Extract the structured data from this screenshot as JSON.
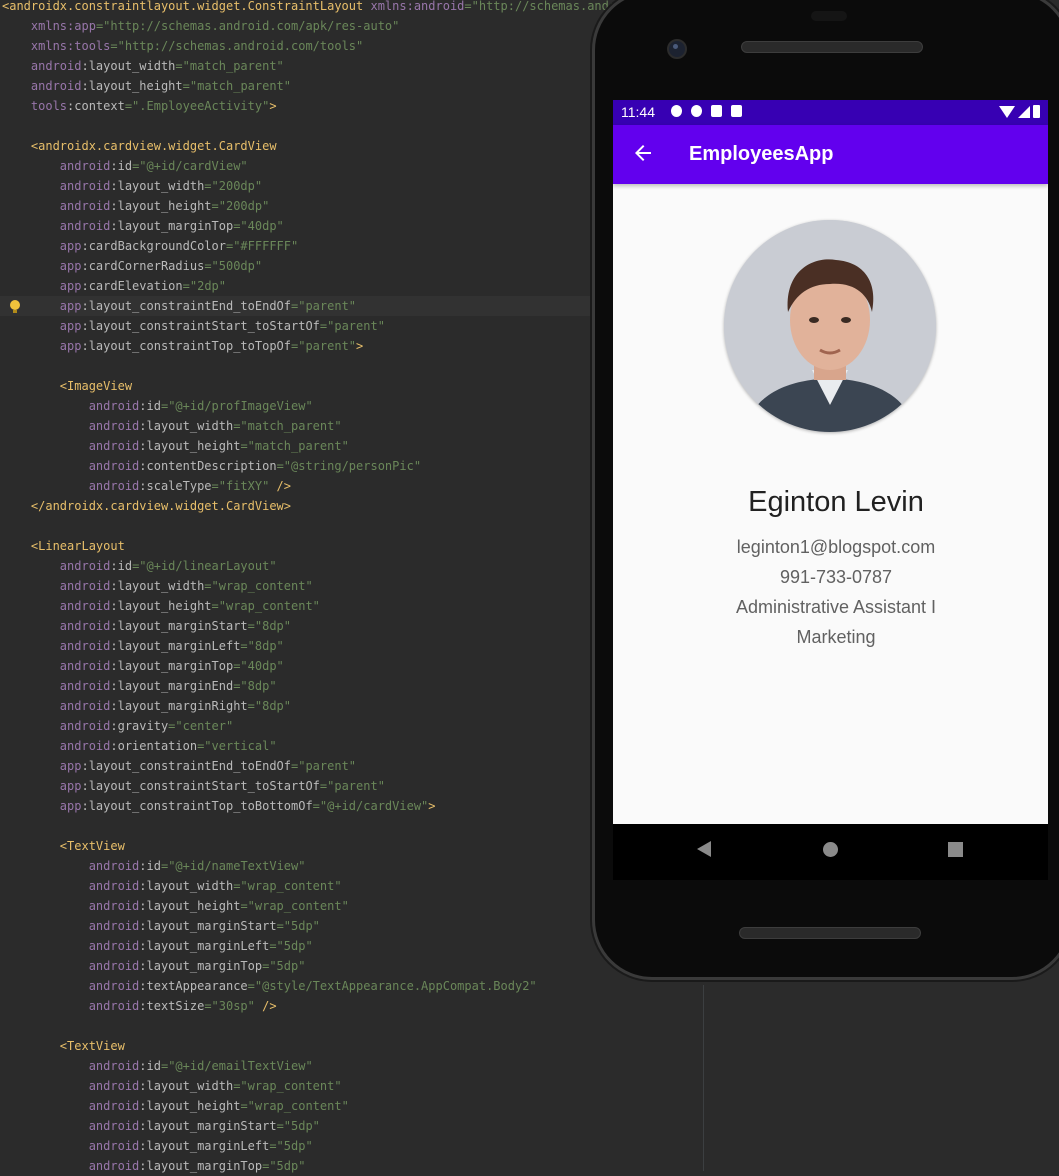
{
  "editor": {
    "lines": [
      [
        [
          "tag",
          "<androidx.constraintlayout.widget.ConstraintLayout "
        ],
        [
          "ns",
          "xmlns:android"
        ],
        [
          "str",
          "=\"http://schemas.andro"
        ]
      ],
      [
        [
          "txt",
          "    "
        ],
        [
          "ns",
          "xmlns:app"
        ],
        [
          "str",
          "=\"http://schemas.android.com/apk/res-auto\""
        ]
      ],
      [
        [
          "txt",
          "    "
        ],
        [
          "ns",
          "xmlns:tools"
        ],
        [
          "str",
          "=\"http://schemas.android.com/tools\""
        ]
      ],
      [
        [
          "txt",
          "    "
        ],
        [
          "ns",
          "android"
        ],
        [
          "at",
          ":layout_width"
        ],
        [
          "str",
          "=\"match_parent\""
        ]
      ],
      [
        [
          "txt",
          "    "
        ],
        [
          "ns",
          "android"
        ],
        [
          "at",
          ":layout_height"
        ],
        [
          "str",
          "=\"match_parent\""
        ]
      ],
      [
        [
          "txt",
          "    "
        ],
        [
          "ns",
          "tools"
        ],
        [
          "at",
          ":context"
        ],
        [
          "str",
          "=\".EmployeeActivity\""
        ],
        [
          "tag",
          ">"
        ]
      ],
      [
        [
          "txt",
          ""
        ]
      ],
      [
        [
          "txt",
          "    "
        ],
        [
          "tag",
          "<androidx.cardview.widget.CardView"
        ]
      ],
      [
        [
          "txt",
          "        "
        ],
        [
          "ns",
          "android"
        ],
        [
          "at",
          ":id"
        ],
        [
          "str",
          "=\"@+id/cardView\""
        ]
      ],
      [
        [
          "txt",
          "        "
        ],
        [
          "ns",
          "android"
        ],
        [
          "at",
          ":layout_width"
        ],
        [
          "str",
          "=\"200dp\""
        ]
      ],
      [
        [
          "txt",
          "        "
        ],
        [
          "ns",
          "android"
        ],
        [
          "at",
          ":layout_height"
        ],
        [
          "str",
          "=\"200dp\""
        ]
      ],
      [
        [
          "txt",
          "        "
        ],
        [
          "ns",
          "android"
        ],
        [
          "at",
          ":layout_marginTop"
        ],
        [
          "str",
          "=\"40dp\""
        ]
      ],
      [
        [
          "txt",
          "        "
        ],
        [
          "ns",
          "app"
        ],
        [
          "at",
          ":cardBackgroundColor"
        ],
        [
          "str",
          "=\"#FFFFFF\""
        ]
      ],
      [
        [
          "txt",
          "        "
        ],
        [
          "ns",
          "app"
        ],
        [
          "at",
          ":cardCornerRadius"
        ],
        [
          "str",
          "=\"500dp\""
        ]
      ],
      [
        [
          "txt",
          "        "
        ],
        [
          "ns",
          "app"
        ],
        [
          "at",
          ":cardElevation"
        ],
        [
          "str",
          "=\"2dp\""
        ]
      ],
      [
        [
          "txt",
          "        "
        ],
        [
          "ns",
          "app"
        ],
        [
          "at",
          ":layout_constraintEnd_toEndOf"
        ],
        [
          "str",
          "=\"parent\""
        ]
      ],
      [
        [
          "txt",
          "        "
        ],
        [
          "ns",
          "app"
        ],
        [
          "at",
          ":layout_constraintStart_toStartOf"
        ],
        [
          "str",
          "=\"parent\""
        ]
      ],
      [
        [
          "txt",
          "        "
        ],
        [
          "ns",
          "app"
        ],
        [
          "at",
          ":layout_constraintTop_toTopOf"
        ],
        [
          "str",
          "=\"parent\""
        ],
        [
          "tag",
          ">"
        ]
      ],
      [
        [
          "txt",
          ""
        ]
      ],
      [
        [
          "txt",
          "        "
        ],
        [
          "tag",
          "<ImageView"
        ]
      ],
      [
        [
          "txt",
          "            "
        ],
        [
          "ns",
          "android"
        ],
        [
          "at",
          ":id"
        ],
        [
          "str",
          "=\"@+id/profImageView\""
        ]
      ],
      [
        [
          "txt",
          "            "
        ],
        [
          "ns",
          "android"
        ],
        [
          "at",
          ":layout_width"
        ],
        [
          "str",
          "=\"match_parent\""
        ]
      ],
      [
        [
          "txt",
          "            "
        ],
        [
          "ns",
          "android"
        ],
        [
          "at",
          ":layout_height"
        ],
        [
          "str",
          "=\"match_parent\""
        ]
      ],
      [
        [
          "txt",
          "            "
        ],
        [
          "ns",
          "android"
        ],
        [
          "at",
          ":contentDescription"
        ],
        [
          "str",
          "=\"@string/personPic\""
        ]
      ],
      [
        [
          "txt",
          "            "
        ],
        [
          "ns",
          "android"
        ],
        [
          "at",
          ":scaleType"
        ],
        [
          "str",
          "=\"fitXY\""
        ],
        [
          "tag",
          " />"
        ]
      ],
      [
        [
          "txt",
          "    "
        ],
        [
          "tag",
          "</androidx.cardview.widget.CardView>"
        ]
      ],
      [
        [
          "txt",
          ""
        ]
      ],
      [
        [
          "txt",
          "    "
        ],
        [
          "tag",
          "<LinearLayout"
        ]
      ],
      [
        [
          "txt",
          "        "
        ],
        [
          "ns",
          "android"
        ],
        [
          "at",
          ":id"
        ],
        [
          "str",
          "=\"@+id/linearLayout\""
        ]
      ],
      [
        [
          "txt",
          "        "
        ],
        [
          "ns",
          "android"
        ],
        [
          "at",
          ":layout_width"
        ],
        [
          "str",
          "=\"wrap_content\""
        ]
      ],
      [
        [
          "txt",
          "        "
        ],
        [
          "ns",
          "android"
        ],
        [
          "at",
          ":layout_height"
        ],
        [
          "str",
          "=\"wrap_content\""
        ]
      ],
      [
        [
          "txt",
          "        "
        ],
        [
          "ns",
          "android"
        ],
        [
          "at",
          ":layout_marginStart"
        ],
        [
          "str",
          "=\"8dp\""
        ]
      ],
      [
        [
          "txt",
          "        "
        ],
        [
          "ns",
          "android"
        ],
        [
          "at",
          ":layout_marginLeft"
        ],
        [
          "str",
          "=\"8dp\""
        ]
      ],
      [
        [
          "txt",
          "        "
        ],
        [
          "ns",
          "android"
        ],
        [
          "at",
          ":layout_marginTop"
        ],
        [
          "str",
          "=\"40dp\""
        ]
      ],
      [
        [
          "txt",
          "        "
        ],
        [
          "ns",
          "android"
        ],
        [
          "at",
          ":layout_marginEnd"
        ],
        [
          "str",
          "=\"8dp\""
        ]
      ],
      [
        [
          "txt",
          "        "
        ],
        [
          "ns",
          "android"
        ],
        [
          "at",
          ":layout_marginRight"
        ],
        [
          "str",
          "=\"8dp\""
        ]
      ],
      [
        [
          "txt",
          "        "
        ],
        [
          "ns",
          "android"
        ],
        [
          "at",
          ":gravity"
        ],
        [
          "str",
          "=\"center\""
        ]
      ],
      [
        [
          "txt",
          "        "
        ],
        [
          "ns",
          "android"
        ],
        [
          "at",
          ":orientation"
        ],
        [
          "str",
          "=\"vertical\""
        ]
      ],
      [
        [
          "txt",
          "        "
        ],
        [
          "ns",
          "app"
        ],
        [
          "at",
          ":layout_constraintEnd_toEndOf"
        ],
        [
          "str",
          "=\"parent\""
        ]
      ],
      [
        [
          "txt",
          "        "
        ],
        [
          "ns",
          "app"
        ],
        [
          "at",
          ":layout_constraintStart_toStartOf"
        ],
        [
          "str",
          "=\"parent\""
        ]
      ],
      [
        [
          "txt",
          "        "
        ],
        [
          "ns",
          "app"
        ],
        [
          "at",
          ":layout_constraintTop_toBottomOf"
        ],
        [
          "str",
          "=\"@+id/cardView\""
        ],
        [
          "tag",
          ">"
        ]
      ],
      [
        [
          "txt",
          ""
        ]
      ],
      [
        [
          "txt",
          "        "
        ],
        [
          "tag",
          "<TextView"
        ]
      ],
      [
        [
          "txt",
          "            "
        ],
        [
          "ns",
          "android"
        ],
        [
          "at",
          ":id"
        ],
        [
          "str",
          "=\"@+id/nameTextView\""
        ]
      ],
      [
        [
          "txt",
          "            "
        ],
        [
          "ns",
          "android"
        ],
        [
          "at",
          ":layout_width"
        ],
        [
          "str",
          "=\"wrap_content\""
        ]
      ],
      [
        [
          "txt",
          "            "
        ],
        [
          "ns",
          "android"
        ],
        [
          "at",
          ":layout_height"
        ],
        [
          "str",
          "=\"wrap_content\""
        ]
      ],
      [
        [
          "txt",
          "            "
        ],
        [
          "ns",
          "android"
        ],
        [
          "at",
          ":layout_marginStart"
        ],
        [
          "str",
          "=\"5dp\""
        ]
      ],
      [
        [
          "txt",
          "            "
        ],
        [
          "ns",
          "android"
        ],
        [
          "at",
          ":layout_marginLeft"
        ],
        [
          "str",
          "=\"5dp\""
        ]
      ],
      [
        [
          "txt",
          "            "
        ],
        [
          "ns",
          "android"
        ],
        [
          "at",
          ":layout_marginTop"
        ],
        [
          "str",
          "=\"5dp\""
        ]
      ],
      [
        [
          "txt",
          "            "
        ],
        [
          "ns",
          "android"
        ],
        [
          "at",
          ":textAppearance"
        ],
        [
          "str",
          "=\"@style/TextAppearance.AppCompat.Body2\""
        ]
      ],
      [
        [
          "txt",
          "            "
        ],
        [
          "ns",
          "android"
        ],
        [
          "at",
          ":textSize"
        ],
        [
          "str",
          "=\"30sp\""
        ],
        [
          "tag",
          " />"
        ]
      ],
      [
        [
          "txt",
          ""
        ]
      ],
      [
        [
          "txt",
          "        "
        ],
        [
          "tag",
          "<TextView"
        ]
      ],
      [
        [
          "txt",
          "            "
        ],
        [
          "ns",
          "android"
        ],
        [
          "at",
          ":id"
        ],
        [
          "str",
          "=\"@+id/emailTextView\""
        ]
      ],
      [
        [
          "txt",
          "            "
        ],
        [
          "ns",
          "android"
        ],
        [
          "at",
          ":layout_width"
        ],
        [
          "str",
          "=\"wrap_content\""
        ]
      ],
      [
        [
          "txt",
          "            "
        ],
        [
          "ns",
          "android"
        ],
        [
          "at",
          ":layout_height"
        ],
        [
          "str",
          "=\"wrap_content\""
        ]
      ],
      [
        [
          "txt",
          "            "
        ],
        [
          "ns",
          "android"
        ],
        [
          "at",
          ":layout_marginStart"
        ],
        [
          "str",
          "=\"5dp\""
        ]
      ],
      [
        [
          "txt",
          "            "
        ],
        [
          "ns",
          "android"
        ],
        [
          "at",
          ":layout_marginLeft"
        ],
        [
          "str",
          "=\"5dp\""
        ]
      ],
      [
        [
          "txt",
          "            "
        ],
        [
          "ns",
          "android"
        ],
        [
          "at",
          ":layout_marginTop"
        ],
        [
          "str",
          "=\"5dp\""
        ]
      ]
    ],
    "highlight_line": 15,
    "bulb_line": 15
  },
  "phone": {
    "status_time": "11:44",
    "app_title": "EmployeesApp",
    "employee": {
      "name": "Eginton Levin",
      "email": "leginton1@blogspot.com",
      "phone": "991-733-0787",
      "job_title": "Administrative Assistant I",
      "department": "Marketing"
    },
    "colors": {
      "status_bar": "#3700b3",
      "app_bar": "#6200ee"
    },
    "icons": {
      "back": "arrow-back-icon",
      "nav_back": "triangle-back-icon",
      "nav_home": "circle-home-icon",
      "nav_recent": "square-recent-icon"
    }
  }
}
